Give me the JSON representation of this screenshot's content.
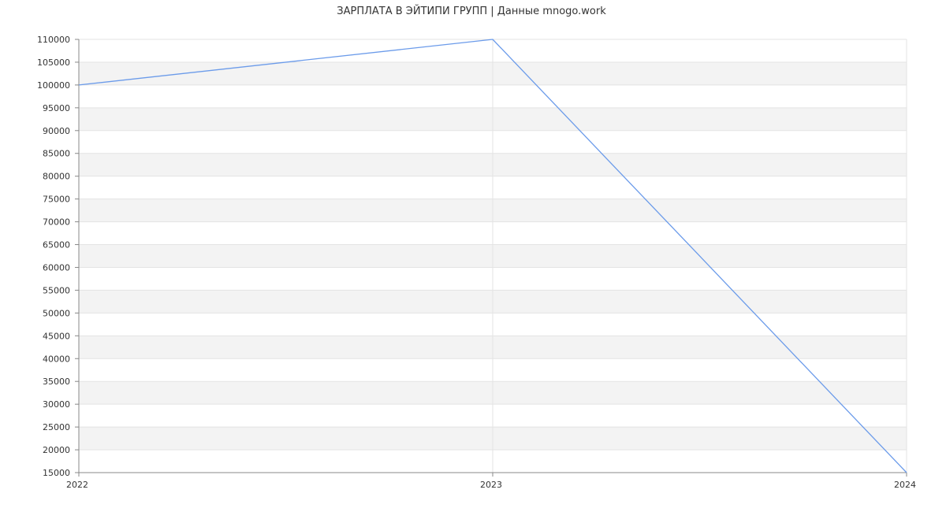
{
  "chart_data": {
    "type": "line",
    "title": "ЗАРПЛАТА В ЭЙТИПИ ГРУПП | Данные mnogo.work",
    "x": [
      "2022",
      "2023",
      "2024"
    ],
    "series": [
      {
        "values": [
          100000,
          110000,
          15000
        ]
      }
    ],
    "ylim": [
      15000,
      110000
    ],
    "ytick_step": 5000,
    "grid": true,
    "line_color": "#6b9bea",
    "band_color": "#f3f3f3",
    "grid_color": "#e3e3e3",
    "axis_color": "#888888"
  }
}
